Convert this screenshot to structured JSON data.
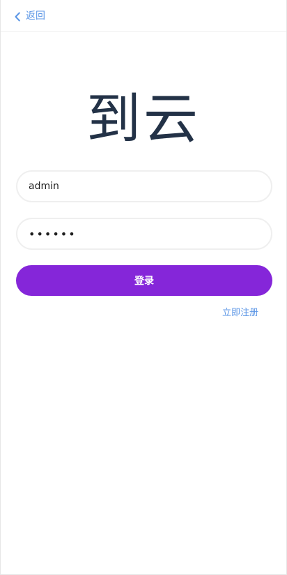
{
  "header": {
    "back_label": "返回",
    "back_icon": "chevron-left-icon"
  },
  "brand": {
    "title": "到云"
  },
  "form": {
    "username_value": "admin",
    "password_value": "••••••",
    "submit_label": "登录",
    "register_label": "立即注册"
  },
  "colors": {
    "accent": "#8526d9",
    "link": "#5b96e6",
    "title_text": "#233247"
  }
}
